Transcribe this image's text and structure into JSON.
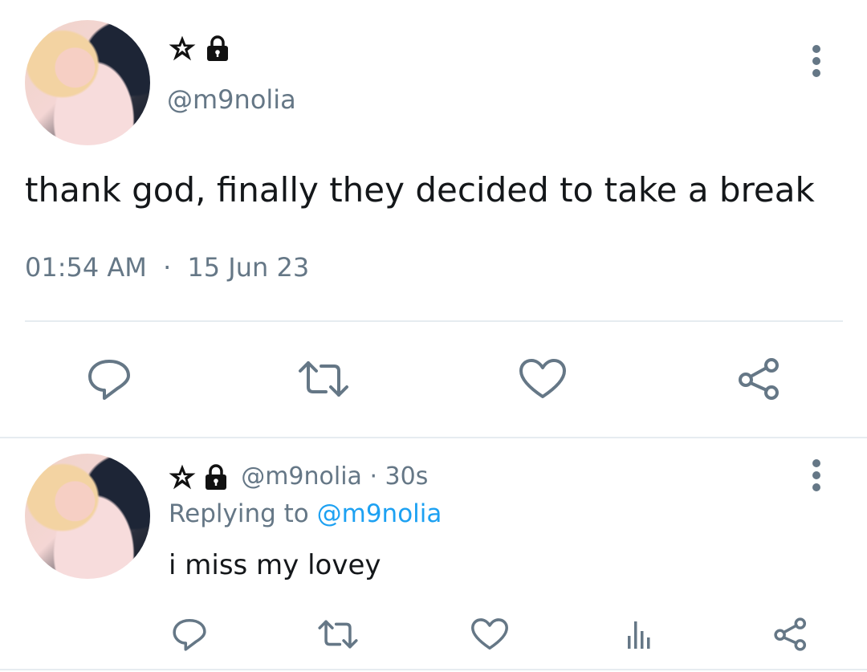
{
  "main_tweet": {
    "handle": "@m9nolia",
    "text": "thank god, finally they decided to take a break",
    "time": "01:54 AM",
    "date": "15 Jun 23",
    "separator": "·"
  },
  "reply_tweet": {
    "handle": "@m9nolia",
    "meta": " · 30s",
    "replying_prefix": "Replying to ",
    "replying_handle": "@m9nolia",
    "text": "i miss my lovey"
  },
  "icons": [
    "pentagram-icon",
    "lock-icon",
    "more-options-icon",
    "reply-icon",
    "retweet-icon",
    "like-icon",
    "share-icon",
    "analytics-icon"
  ],
  "colors": {
    "text": "#14171a",
    "muted": "#657786",
    "link": "#1da1f2",
    "divider": "#e6ecf0"
  }
}
